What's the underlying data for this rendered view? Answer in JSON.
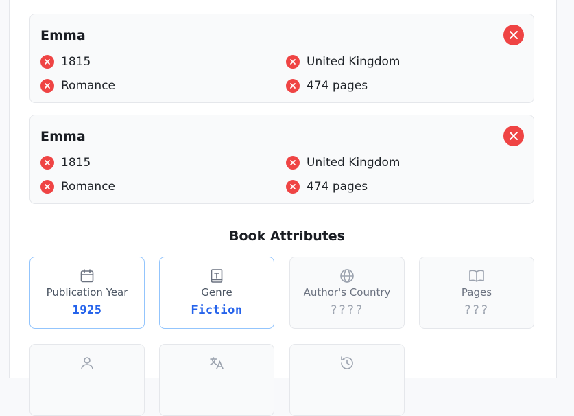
{
  "guesses": [
    {
      "title": "Emma",
      "year": "1815",
      "country": "United Kingdom",
      "genre": "Romance",
      "pages": "474 pages"
    },
    {
      "title": "Emma",
      "year": "1815",
      "country": "United Kingdom",
      "genre": "Romance",
      "pages": "474 pages"
    }
  ],
  "attributes": {
    "title": "Book Attributes",
    "tiles": [
      {
        "label": "Publication Year",
        "value": "1925",
        "icon": "calendar-icon",
        "state": "revealed"
      },
      {
        "label": "Genre",
        "value": "Fiction",
        "icon": "book-icon",
        "state": "revealed"
      },
      {
        "label": "Author's Country",
        "value": "????",
        "icon": "globe-icon",
        "state": "hidden"
      },
      {
        "label": "Pages",
        "value": "???",
        "icon": "open-book-icon",
        "state": "hidden"
      }
    ],
    "more_tiles_icons": [
      "person-icon",
      "translate-icon",
      "history-icon"
    ]
  },
  "colors": {
    "wrong": "#ef4444",
    "accent": "#2563eb",
    "revealed_border": "#93c5fd"
  }
}
